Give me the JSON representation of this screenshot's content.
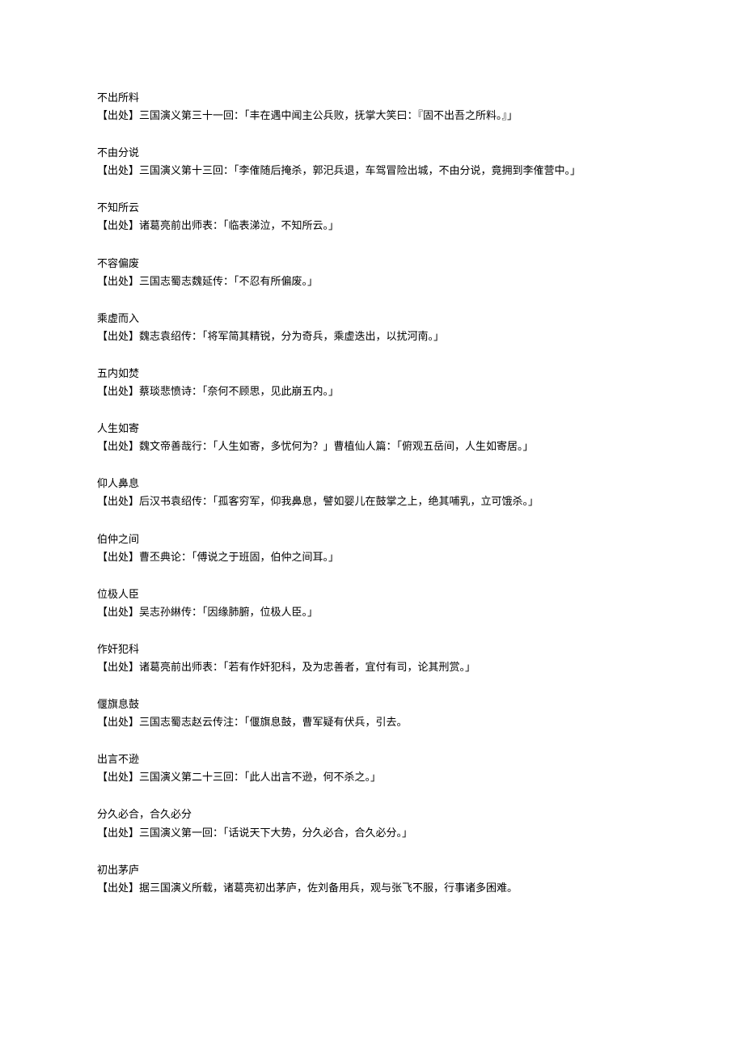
{
  "entries": [
    {
      "idiom": "不出所料",
      "source": "【出处】三国演义第三十一回：「丰在遇中闻主公兵败，抚掌大笑曰：『固不出吾之所料。』」"
    },
    {
      "idiom": "不由分说",
      "source": "【出处】三国演义第十三回：「李傕随后掩杀，郭汜兵退，车驾冒险出城，不由分说，竟拥到李傕营中。」"
    },
    {
      "idiom": "不知所云",
      "source": "【出处】诸葛亮前出师表：「临表涕泣，不知所云。」"
    },
    {
      "idiom": "不容偏废",
      "source": "【出处】三国志蜀志魏延传：「不忍有所偏废。」"
    },
    {
      "idiom": "乘虚而入",
      "source": "【出处】魏志袁绍传：「将军简其精锐，分为奇兵，乘虚迭出，以扰河南。」"
    },
    {
      "idiom": "五内如焚",
      "source": "【出处】蔡琰悲愤诗：「奈何不顾思，见此崩五内。」"
    },
    {
      "idiom": "人生如寄",
      "source": "【出处】魏文帝善哉行：「人生如寄，多忧何为？」曹植仙人篇：「俯观五岳间，人生如寄居。」"
    },
    {
      "idiom": "仰人鼻息",
      "source": "【出处】后汉书袁绍传：「孤客穷军，仰我鼻息，譬如婴儿在鼓掌之上，绝其哺乳，立可饿杀。」"
    },
    {
      "idiom": "伯仲之间",
      "source": "【出处】曹丕典论：「傅说之于班固，伯仲之间耳。」"
    },
    {
      "idiom": "位极人臣",
      "source": "【出处】吴志孙綝传：「因缘肺腑，位极人臣。」"
    },
    {
      "idiom": "作奸犯科",
      "source": "【出处】诸葛亮前出师表：「若有作奸犯科，及为忠善者，宜付有司，论其刑赏。」"
    },
    {
      "idiom": "偃旗息鼓",
      "source": "【出处】三国志蜀志赵云传注：「偃旗息鼓，曹军疑有伏兵，引去。"
    },
    {
      "idiom": "出言不逊",
      "source": "【出处】三国演义第二十三回：「此人出言不逊，何不杀之。」"
    },
    {
      "idiom": "分久必合，合久必分",
      "source": "【出处】三国演义第一回：「话说天下大势，分久必合，合久必分。」"
    },
    {
      "idiom": "初出茅庐",
      "source": "【出处】据三国演义所载，诸葛亮初出茅庐，佐刘备用兵，观与张飞不服，行事诸多困难。"
    }
  ]
}
